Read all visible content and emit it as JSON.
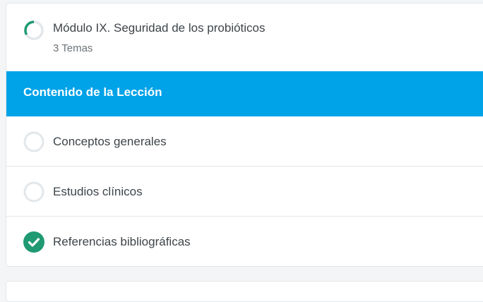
{
  "module": {
    "title": "Módulo IX. Seguridad de los probióticos",
    "subtitle": "3 Temas",
    "progress_fraction": 0.33
  },
  "lesson_content": {
    "heading": "Contenido de la Lección"
  },
  "topics": [
    {
      "label": "Conceptos generales",
      "status": "incomplete"
    },
    {
      "label": "Estudios clínicos",
      "status": "incomplete"
    },
    {
      "label": "Referencias bibliográficas",
      "status": "complete"
    }
  ],
  "colors": {
    "accent": "#00a2e8",
    "complete": "#1f9a72",
    "incomplete_ring": "#e3e7ea",
    "text": "#3e4449",
    "subtext": "#6d7378"
  },
  "icons": {
    "module_progress": "progress-ring-icon",
    "topic_incomplete": "empty-circle-icon",
    "topic_complete": "check-circle-icon"
  }
}
